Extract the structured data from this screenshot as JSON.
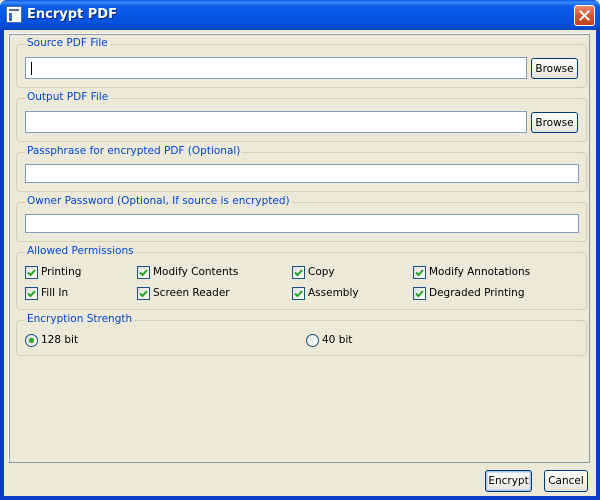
{
  "window": {
    "title": "Encrypt PDF",
    "icon": "app-document-icon",
    "close_icon": "close-icon"
  },
  "source": {
    "label": "Source PDF File",
    "value": "",
    "browse_label": "Browse"
  },
  "output": {
    "label": "Output PDF File",
    "value": "",
    "browse_label": "Browse"
  },
  "passphrase": {
    "label": "Passphrase for encrypted PDF (Optional)",
    "value": ""
  },
  "owner_password": {
    "label": "Owner Password (Optional, If source is encrypted)",
    "value": ""
  },
  "permissions": {
    "label": "Allowed Permissions",
    "items": [
      {
        "label": "Printing",
        "checked": true
      },
      {
        "label": "Modify Contents",
        "checked": true
      },
      {
        "label": "Copy",
        "checked": true
      },
      {
        "label": "Modify Annotations",
        "checked": true
      },
      {
        "label": "Fill In",
        "checked": true
      },
      {
        "label": "Screen Reader",
        "checked": true
      },
      {
        "label": "Assembly",
        "checked": true
      },
      {
        "label": "Degraded Printing",
        "checked": true
      }
    ]
  },
  "strength": {
    "label": "Encryption Strength",
    "options": [
      {
        "label": "128 bit",
        "selected": true
      },
      {
        "label": "40 bit",
        "selected": false
      }
    ]
  },
  "footer": {
    "encrypt_label": "Encrypt",
    "cancel_label": "Cancel"
  },
  "colors": {
    "titlebar": "#0454E2",
    "group_label": "#0046D5",
    "check_mark": "#21A121",
    "radio_dot": "#2FA82F",
    "dialog_bg": "#ECE9D8"
  }
}
